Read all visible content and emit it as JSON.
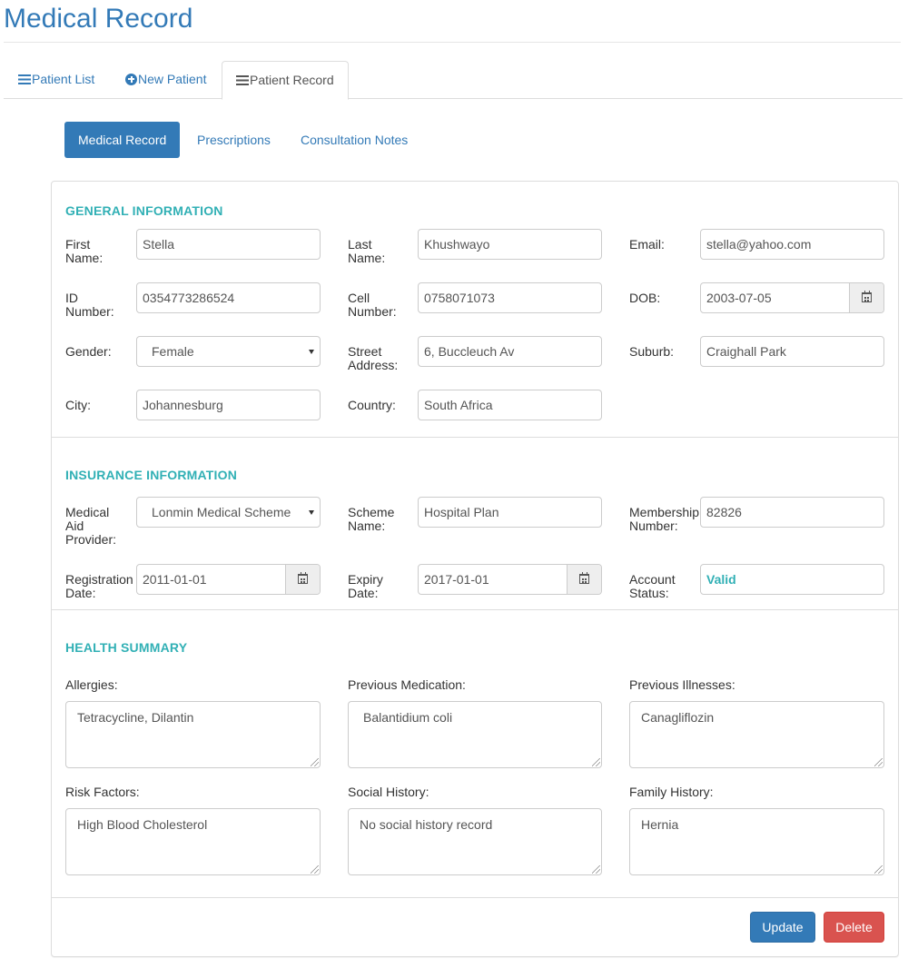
{
  "page": {
    "title": "Medical Record"
  },
  "tabs": [
    {
      "label": "Patient List",
      "icon": "list-icon"
    },
    {
      "label": "New Patient",
      "icon": "plus-circle-icon"
    },
    {
      "label": "Patient Record",
      "icon": "list-icon"
    }
  ],
  "pills": [
    "Medical Record",
    "Prescriptions",
    "Consultation Notes"
  ],
  "general": {
    "title": "GENERAL INFORMATION",
    "first_name": {
      "label_1": "First",
      "label_2": "Name:",
      "value": "Stella"
    },
    "last_name": {
      "label_1": "Last",
      "label_2": "Name:",
      "value": "Khushwayo"
    },
    "email": {
      "label": "Email:",
      "value": "stella@yahoo.com"
    },
    "id_number": {
      "label_1": "ID",
      "label_2": "Number:",
      "value": "0354773286524"
    },
    "cell_number": {
      "label_1": "Cell",
      "label_2": "Number:",
      "value": "0758071073"
    },
    "dob": {
      "label": "DOB:",
      "value": "2003-07-05"
    },
    "gender": {
      "label": "Gender:",
      "value": "Female"
    },
    "street": {
      "label_1": "Street",
      "label_2": "Address:",
      "value": "6, Buccleuch Av"
    },
    "suburb": {
      "label": "Suburb:",
      "value": "Craighall Park"
    },
    "city": {
      "label": "City:",
      "value": "Johannesburg"
    },
    "country": {
      "label": "Country:",
      "value": "South Africa"
    }
  },
  "insurance": {
    "title": "INSURANCE INFORMATION",
    "provider": {
      "label_1": "Medical",
      "label_2": "Aid",
      "label_3": "Provider:",
      "value": "Lonmin Medical Scheme"
    },
    "scheme": {
      "label_1": "Scheme",
      "label_2": "Name:",
      "value": "Hospital Plan"
    },
    "membership": {
      "label_1": "Membership",
      "label_2": "Number:",
      "value": "82826"
    },
    "registration": {
      "label_1": "Registration",
      "label_2": "Date:",
      "value": "2011-01-01"
    },
    "expiry": {
      "label_1": "Expiry",
      "label_2": "Date:",
      "value": "2017-01-01"
    },
    "status": {
      "label_1": "Account",
      "label_2": "Status:",
      "value": "Valid"
    }
  },
  "health": {
    "title": "HEALTH SUMMARY",
    "allergies": {
      "label": "Allergies:",
      "value": "Tetracycline, Dilantin"
    },
    "prev_medication": {
      "label": "Previous Medication:",
      "value": "Balantidium coli"
    },
    "prev_illnesses": {
      "label": "Previous Illnesses:",
      "value": "Canagliflozin"
    },
    "risk_factors": {
      "label": "Risk Factors:",
      "value": "High Blood Cholesterol"
    },
    "social_history": {
      "label": "Social History:",
      "value": "No social history record"
    },
    "family_history": {
      "label": "Family History:",
      "value": "Hernia"
    }
  },
  "actions": {
    "update": "Update",
    "delete": "Delete"
  },
  "colors": {
    "primary": "#337ab7",
    "section_title": "#31b0b5",
    "danger": "#d9534f"
  }
}
